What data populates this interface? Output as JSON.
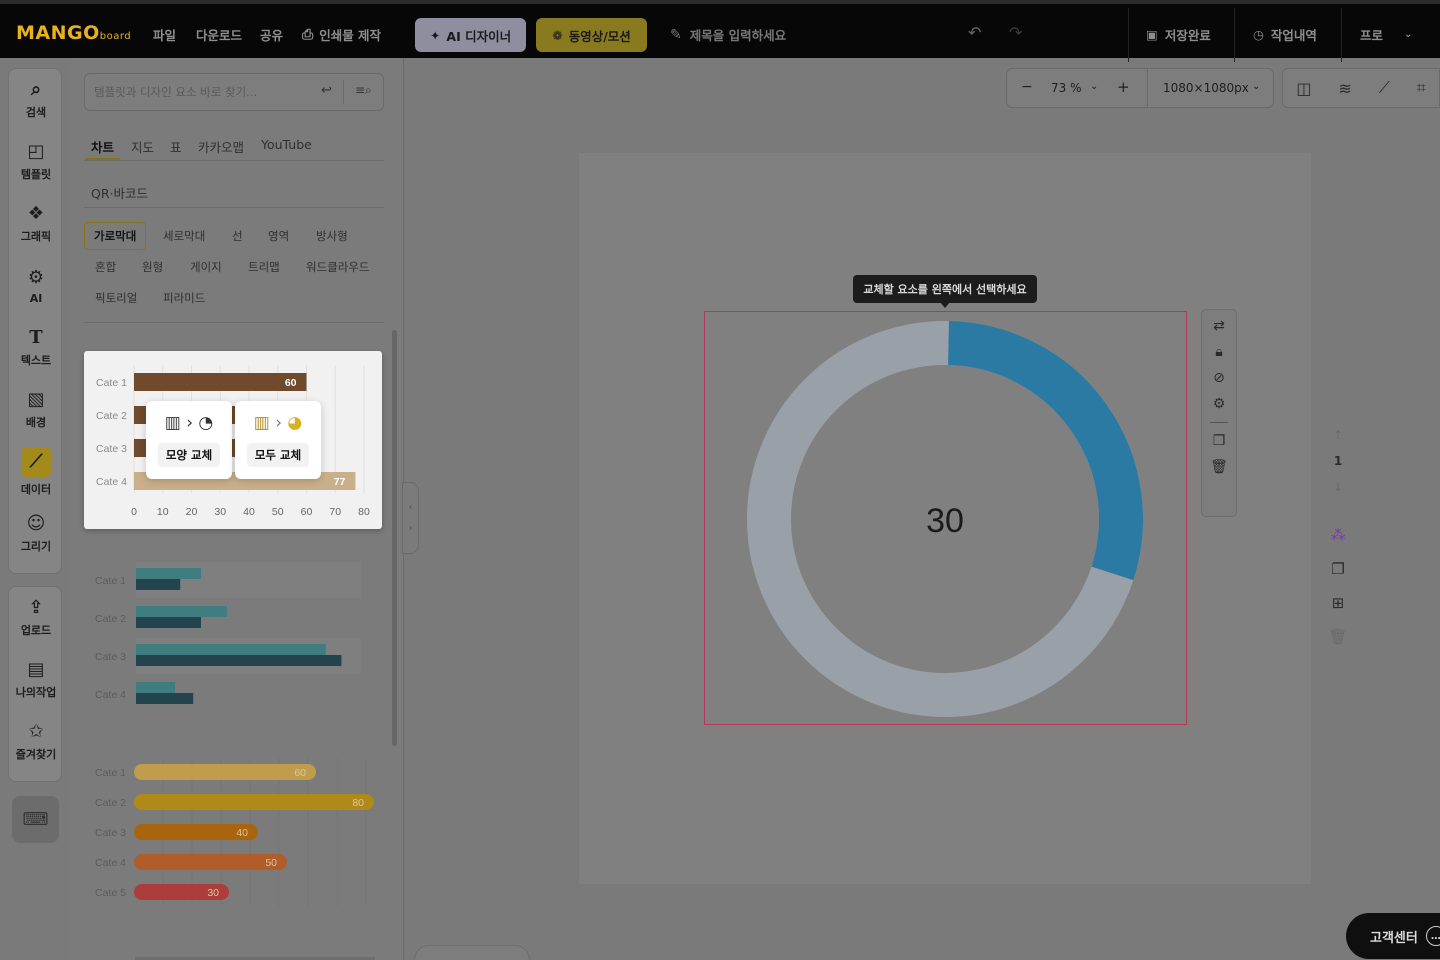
{
  "topbar": {
    "logo_main": "MANGO",
    "logo_sub": "board",
    "menu": [
      "파일",
      "다운로드",
      "공유"
    ],
    "print_label": "인쇄물 제작",
    "ai_label": "AI 디자이너",
    "video_label": "동영상/모션",
    "title_placeholder": "제목을 입력하세요",
    "saved_label": "저장완료",
    "history_label": "작업내역",
    "plan_label": "프로"
  },
  "rail": {
    "items": [
      "검색",
      "템플릿",
      "그래픽",
      "AI",
      "텍스트",
      "배경",
      "데이터",
      "그리기"
    ],
    "items2": [
      "업로드",
      "나의작업",
      "즐겨찾기"
    ]
  },
  "panel": {
    "search_placeholder": "템플릿과 디자인 요소 바로 찾기...",
    "tabs": [
      "차트",
      "지도",
      "표",
      "카카오맵",
      "YouTube"
    ],
    "tab_qr": "QR·바코드",
    "chips_row1": [
      "가로막대",
      "세로막대",
      "선",
      "영역",
      "방사형"
    ],
    "chips_row2": [
      "혼합",
      "원형",
      "게이지",
      "트리맵",
      "워드클라우드"
    ],
    "chips_row3": [
      "픽토리얼",
      "피라미드"
    ],
    "replace_shape_label": "모양 교체",
    "replace_all_label": "모두 교체"
  },
  "chart_data": [
    {
      "type": "bar",
      "orientation": "horizontal",
      "categories": [
        "Cate 1",
        "Cate 2",
        "Cate 3",
        "Cate 4"
      ],
      "values": [
        60,
        40,
        60,
        77
      ],
      "data_labels": [
        "60",
        "",
        "",
        "77"
      ],
      "xticks": [
        "0",
        "10",
        "20",
        "30",
        "40",
        "50",
        "60",
        "70",
        "80"
      ],
      "xlim": [
        0,
        80
      ],
      "color": "#6f4a2c"
    },
    {
      "type": "bar",
      "orientation": "horizontal",
      "categories": [
        "Cate 1",
        "Cate 2",
        "Cate 3",
        "Cate 4"
      ],
      "series": [
        {
          "values": [
            25,
            35,
            73,
            15
          ]
        },
        {
          "values": [
            17,
            25,
            79,
            22
          ]
        }
      ]
    },
    {
      "type": "bar",
      "orientation": "horizontal",
      "categories": [
        "Cate 1",
        "Cate 2",
        "Cate 3",
        "Cate 4",
        "Cate 5"
      ],
      "values": [
        60,
        80,
        40,
        50,
        30
      ],
      "data_labels": [
        "60",
        "80",
        "40",
        "50",
        "30"
      ],
      "colors": [
        "#bf9d4c",
        "#b08a18",
        "#a9640d",
        "#b05d2a",
        "#ad3d3a"
      ]
    },
    {
      "type": "pie",
      "variant": "donut",
      "center_label": "30",
      "values": [
        30,
        70
      ],
      "colors": [
        "#2b7aa3",
        "#9aa0a8"
      ]
    }
  ],
  "workspace": {
    "zoom": "73 %",
    "size": "1080×1080px",
    "tooltip": "교체할 요소를 왼쪽에서 선택하세요",
    "page_number": "1",
    "help_label": "고객센터"
  }
}
